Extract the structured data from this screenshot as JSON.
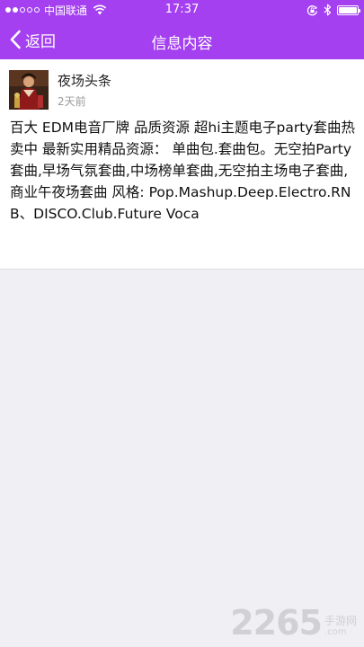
{
  "colors": {
    "accent": "#a440f0",
    "background": "#efeff4",
    "card": "#ffffff"
  },
  "status_bar": {
    "carrier": "中国联通",
    "time": "17:37",
    "signal_level": 2,
    "signal_max": 5,
    "battery_level": 1.0,
    "icons": [
      "wifi-icon",
      "rotation-lock-icon",
      "bluetooth-icon",
      "battery-icon"
    ]
  },
  "nav": {
    "back_label": "返回",
    "title": "信息内容"
  },
  "post": {
    "author": "夜场头条",
    "time": "2天前",
    "content": "百大 EDM电音厂牌 品质资源 超hi主题电子party套曲热卖中 最新实用精品资源： 单曲包.套曲包。无空拍Party套曲,早场气氛套曲,中场榜单套曲,无空拍主场电子套曲,商业午夜场套曲 风格: Pop.Mashup.Deep.Electro.RNB、DISCO.Club.Future Voca"
  },
  "watermark": {
    "number": "2265",
    "cn": "手游网",
    "domain": ".com"
  }
}
